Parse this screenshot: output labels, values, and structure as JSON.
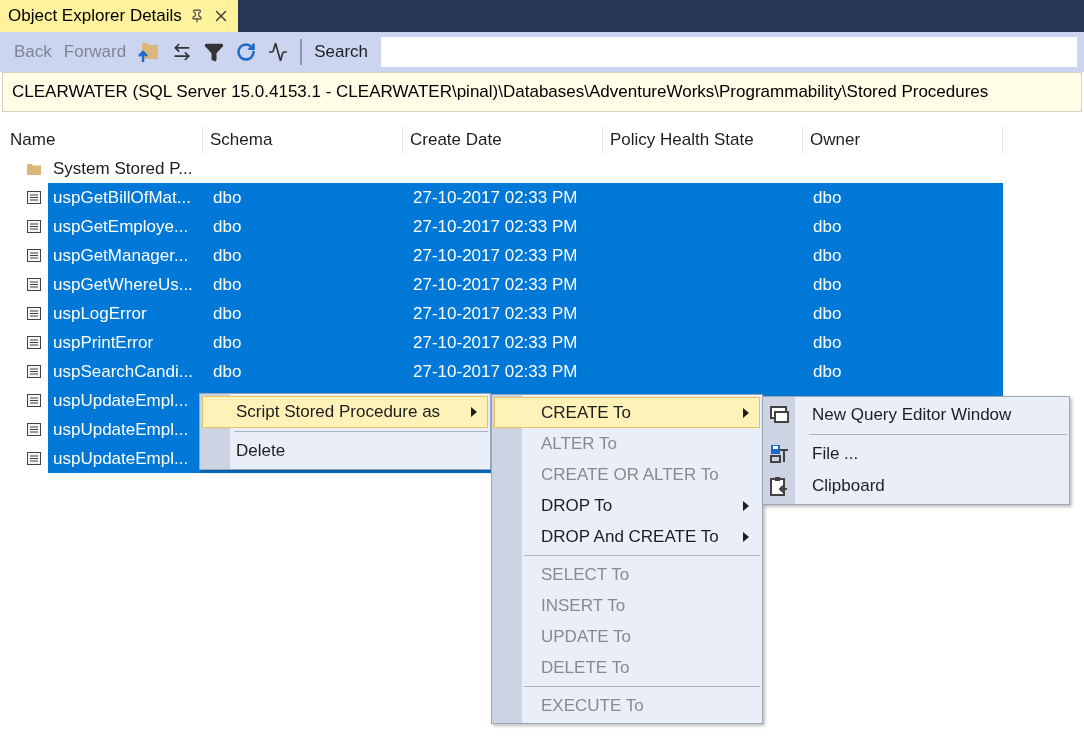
{
  "tab": {
    "title": "Object Explorer Details"
  },
  "toolbar": {
    "buttons": [
      {
        "label": "Back",
        "disabled": true
      },
      {
        "label": "Forward",
        "disabled": true
      }
    ],
    "search_label": "Search"
  },
  "path": "CLEARWATER (SQL Server 15.0.4153.1 - CLEARWATER\\pinal)\\Databases\\AdventureWorks\\Programmability\\Stored Procedures",
  "columns": [
    "Name",
    "Schema",
    "Create Date",
    "Policy Health State",
    "Owner"
  ],
  "rows": [
    {
      "kind": "folder",
      "name": "System Stored P...",
      "selected": false
    },
    {
      "kind": "procedure",
      "name": "uspGetBillOfMat...",
      "schema": "dbo",
      "create_date": "27-10-2017 02:33 PM",
      "owner": "dbo",
      "selected": true
    },
    {
      "kind": "procedure",
      "name": "uspGetEmploye...",
      "schema": "dbo",
      "create_date": "27-10-2017 02:33 PM",
      "owner": "dbo",
      "selected": true
    },
    {
      "kind": "procedure",
      "name": "uspGetManager...",
      "schema": "dbo",
      "create_date": "27-10-2017 02:33 PM",
      "owner": "dbo",
      "selected": true
    },
    {
      "kind": "procedure",
      "name": "uspGetWhereUs...",
      "schema": "dbo",
      "create_date": "27-10-2017 02:33 PM",
      "owner": "dbo",
      "selected": true
    },
    {
      "kind": "procedure",
      "name": "uspLogError",
      "schema": "dbo",
      "create_date": "27-10-2017 02:33 PM",
      "owner": "dbo",
      "selected": true
    },
    {
      "kind": "procedure",
      "name": "uspPrintError",
      "schema": "dbo",
      "create_date": "27-10-2017 02:33 PM",
      "owner": "dbo",
      "selected": true
    },
    {
      "kind": "procedure",
      "name": "uspSearchCandi...",
      "schema": "dbo",
      "create_date": "27-10-2017 02:33 PM",
      "owner": "dbo",
      "selected": true
    },
    {
      "kind": "procedure",
      "name": "uspUpdateEmpl...",
      "selected": true
    },
    {
      "kind": "procedure",
      "name": "uspUpdateEmpl...",
      "selected": true
    },
    {
      "kind": "procedure",
      "name": "uspUpdateEmpl...",
      "selected": true
    }
  ],
  "context_menu": [
    {
      "kind": "item",
      "label": "Script Stored Procedure as",
      "selected": true,
      "submenu": true
    },
    {
      "kind": "separator"
    },
    {
      "kind": "item",
      "label": "Delete",
      "selected": false,
      "submenu": false
    }
  ],
  "script_submenu": [
    {
      "kind": "item",
      "label": "CREATE To",
      "selected": true,
      "disabled": false,
      "submenu": true
    },
    {
      "kind": "item",
      "label": "ALTER To",
      "selected": false,
      "disabled": true,
      "submenu": false
    },
    {
      "kind": "item",
      "label": "CREATE OR ALTER To",
      "selected": false,
      "disabled": true,
      "submenu": false
    },
    {
      "kind": "item",
      "label": "DROP To",
      "selected": false,
      "disabled": false,
      "submenu": true
    },
    {
      "kind": "item",
      "label": "DROP And CREATE To",
      "selected": false,
      "disabled": false,
      "submenu": true
    },
    {
      "kind": "separator"
    },
    {
      "kind": "item",
      "label": "SELECT To",
      "selected": false,
      "disabled": true,
      "submenu": false
    },
    {
      "kind": "item",
      "label": "INSERT To",
      "selected": false,
      "disabled": true,
      "submenu": false
    },
    {
      "kind": "item",
      "label": "UPDATE To",
      "selected": false,
      "disabled": true,
      "submenu": false
    },
    {
      "kind": "item",
      "label": "DELETE To",
      "selected": false,
      "disabled": true,
      "submenu": false
    },
    {
      "kind": "separator"
    },
    {
      "kind": "item",
      "label": "EXECUTE To",
      "selected": false,
      "disabled": true,
      "submenu": false
    }
  ],
  "create_submenu": [
    {
      "kind": "item",
      "label": "New Query Editor Window"
    },
    {
      "kind": "separator"
    },
    {
      "kind": "item",
      "label": "File ..."
    },
    {
      "kind": "item",
      "label": "Clipboard"
    }
  ]
}
